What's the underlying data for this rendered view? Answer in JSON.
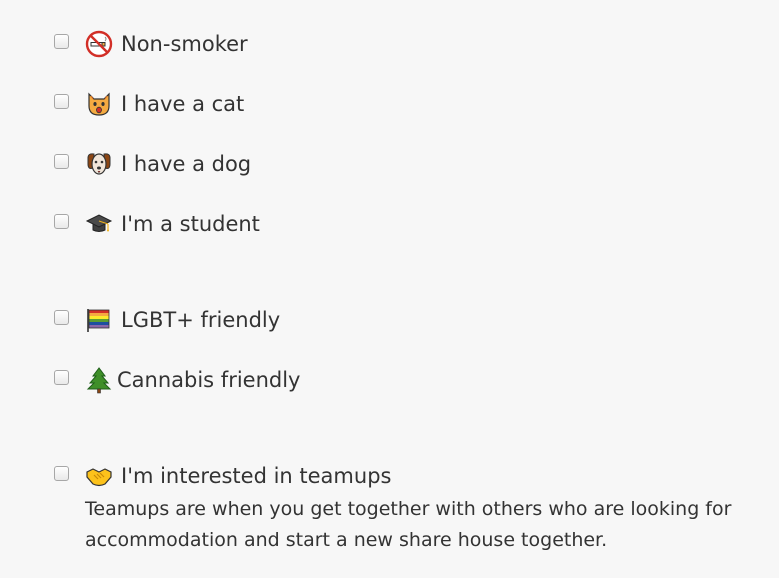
{
  "options": [
    {
      "label": "Non-smoker",
      "icon": "no-smoking-icon",
      "checked": false
    },
    {
      "label": "I have a cat",
      "icon": "cat-face-icon",
      "checked": false
    },
    {
      "label": "I have a dog",
      "icon": "dog-face-icon",
      "checked": false
    },
    {
      "label": "I'm a student",
      "icon": "graduation-cap-icon",
      "checked": false
    },
    {
      "label": "LGBT+ friendly",
      "icon": "rainbow-flag-icon",
      "checked": false
    },
    {
      "label": "Cannabis friendly",
      "icon": "evergreen-tree-icon",
      "checked": false
    },
    {
      "label": "I'm interested in teamups",
      "icon": "handshake-icon",
      "checked": false
    }
  ],
  "teamups_description": "Teamups are when you get together with others who are looking for accommodation and start a new share house together.",
  "colors": {
    "background": "#f7f7f7",
    "text": "#333333",
    "checkbox_border": "#a7a7a7"
  }
}
